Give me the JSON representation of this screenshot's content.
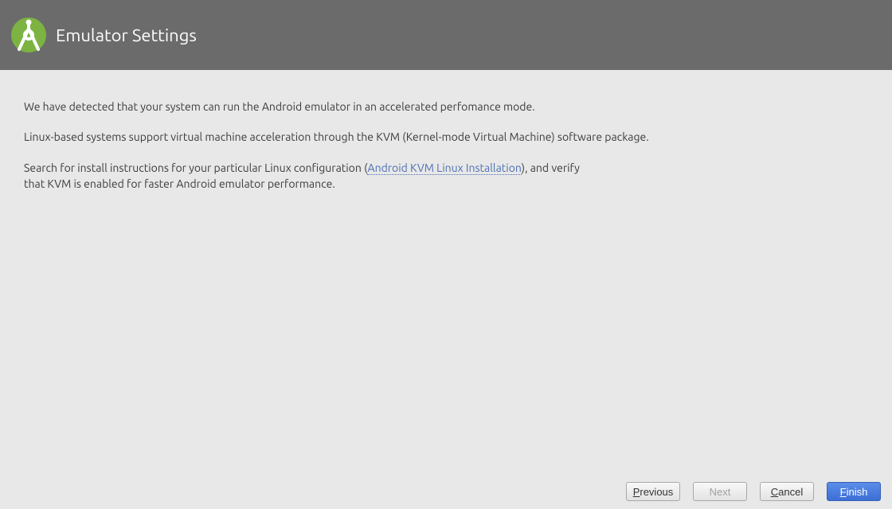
{
  "header": {
    "title": "Emulator Settings"
  },
  "content": {
    "line1": "We have detected that your system can run the Android emulator in an accelerated perfomance mode.",
    "line2": "Linux-based systems support virtual machine acceleration through the KVM (Kernel-mode Virtual Machine) software package.",
    "line3_pre": "Search for install instructions for your particular Linux configuration (",
    "line3_link": "Android KVM Linux Installation",
    "line3_post": "), and verify",
    "line4": "that KVM is enabled for faster Android emulator performance."
  },
  "footer": {
    "previous": "revious",
    "previous_hotkey": "P",
    "next": "Next",
    "cancel": "ancel",
    "cancel_hotkey": "C",
    "finish": "inish",
    "finish_hotkey": "F"
  }
}
